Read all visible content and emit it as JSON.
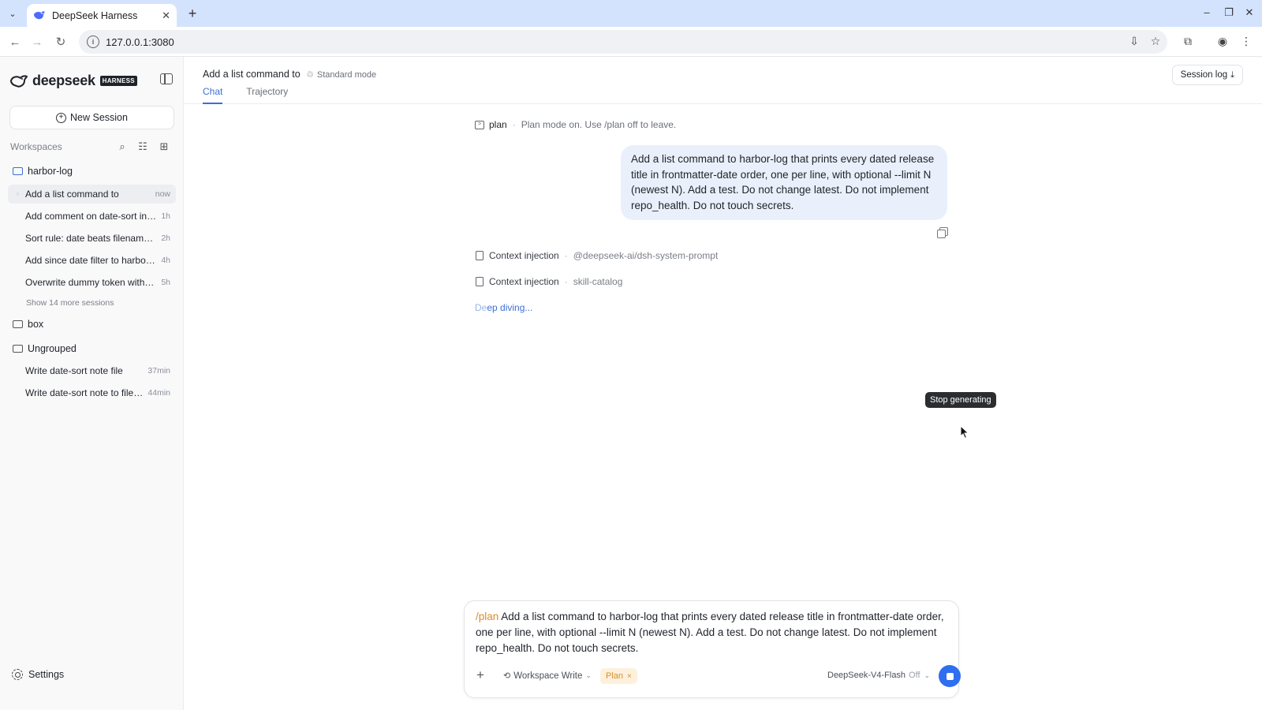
{
  "browser": {
    "tab_title": "DeepSeek Harness",
    "url": "127.0.0.1:3080"
  },
  "sidebar": {
    "brand_name": "deepseek",
    "brand_badge": "HARNESS",
    "new_session_label": "New Session",
    "workspaces_label": "Workspaces",
    "groups": [
      {
        "name": "harbor-log",
        "sessions": [
          {
            "title": "Add a list command to",
            "time": "now"
          },
          {
            "title": "Add comment on date-sort in …",
            "time": "1h"
          },
          {
            "title": "Sort rule: date beats filename…",
            "time": "2h"
          },
          {
            "title": "Add since date filter to harbor…",
            "time": "4h"
          },
          {
            "title": "Overwrite dummy token with …",
            "time": "5h"
          }
        ],
        "more_label": "Show 14 more sessions"
      },
      {
        "name": "box",
        "sessions": []
      },
      {
        "name": "Ungrouped",
        "sessions": [
          {
            "title": "Write date-sort note file",
            "time": "37min"
          },
          {
            "title": "Write date-sort note to file …",
            "time": "44min"
          }
        ]
      }
    ],
    "settings_label": "Settings"
  },
  "main": {
    "session_title": "Add a list command to",
    "mode_label": "Standard mode",
    "tabs": [
      {
        "label": "Chat",
        "active": true
      },
      {
        "label": "Trajectory",
        "active": false
      }
    ],
    "session_log_label": "Session log",
    "plan_command": "plan",
    "plan_note": "Plan mode on. Use /plan off to leave.",
    "user_message": "Add a list command to harbor-log that prints every dated release title in frontmatter-date order, one per line, with optional --limit N (newest N). Add a test. Do not change latest. Do not implement repo_health. Do not touch secrets.",
    "context_injections": [
      {
        "label": "Context injection",
        "value": "@deepseek-ai/dsh-system-prompt"
      },
      {
        "label": "Context injection",
        "value": "skill-catalog"
      }
    ],
    "status_fade": "De",
    "status_rest": "ep diving...",
    "tooltip": "Stop generating"
  },
  "composer": {
    "slash_command": "/plan",
    "text": " Add a list command to harbor-log that prints every dated release title in frontmatter-date order, one per line, with optional --limit N (newest N). Add a test. Do not change latest. Do not implement repo_health. Do not touch secrets.",
    "workspace_mode": "Workspace Write",
    "plan_chip": "Plan",
    "model": "DeepSeek-V4-Flash",
    "model_thinking": "Off"
  },
  "colors": {
    "accent": "#3b6fd8",
    "stop_button": "#2f6ef0",
    "plan_chip": "#d98e2b",
    "user_bubble": "#eaf0fb"
  }
}
